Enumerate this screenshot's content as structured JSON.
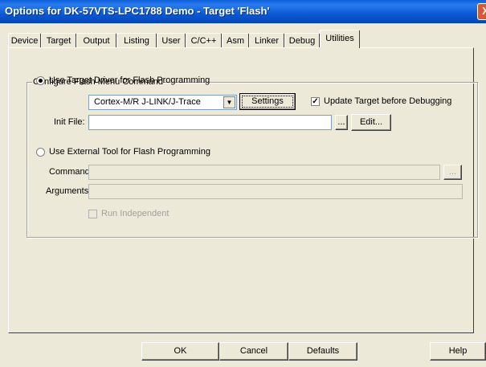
{
  "window": {
    "title": "Options for DK-57VTS-LPC1788 Demo - Target 'Flash'",
    "close_glyph": "X"
  },
  "tabs": [
    {
      "label": "Device"
    },
    {
      "label": "Target"
    },
    {
      "label": "Output"
    },
    {
      "label": "Listing"
    },
    {
      "label": "User"
    },
    {
      "label": "C/C++"
    },
    {
      "label": "Asm"
    },
    {
      "label": "Linker"
    },
    {
      "label": "Debug"
    },
    {
      "label": "Utilities"
    }
  ],
  "group": {
    "legend": "Configure Flash Menu Command",
    "use_target_driver": {
      "label": "Use Target Driver for Flash Programming",
      "selected": true
    },
    "driver_select": {
      "value": "Cortex-M/R J-LINK/J-Trace"
    },
    "settings_button": "Settings",
    "update_target": {
      "label": "Update Target before Debugging",
      "checked": true,
      "check_glyph": "✓"
    },
    "init_file": {
      "label": "Init File:",
      "value": "",
      "browse": "...",
      "edit": "Edit..."
    },
    "use_external_tool": {
      "label": "Use External Tool for Flash Programming",
      "selected": false
    },
    "command": {
      "label": "Command:",
      "value": "",
      "browse": "..."
    },
    "arguments": {
      "label": "Arguments:",
      "value": ""
    },
    "run_independent": {
      "label": "Run Independent",
      "checked": false
    }
  },
  "footer": {
    "ok": "OK",
    "cancel": "Cancel",
    "defaults": "Defaults",
    "help": "Help"
  },
  "icons": {
    "combo_arrow": "▼"
  }
}
